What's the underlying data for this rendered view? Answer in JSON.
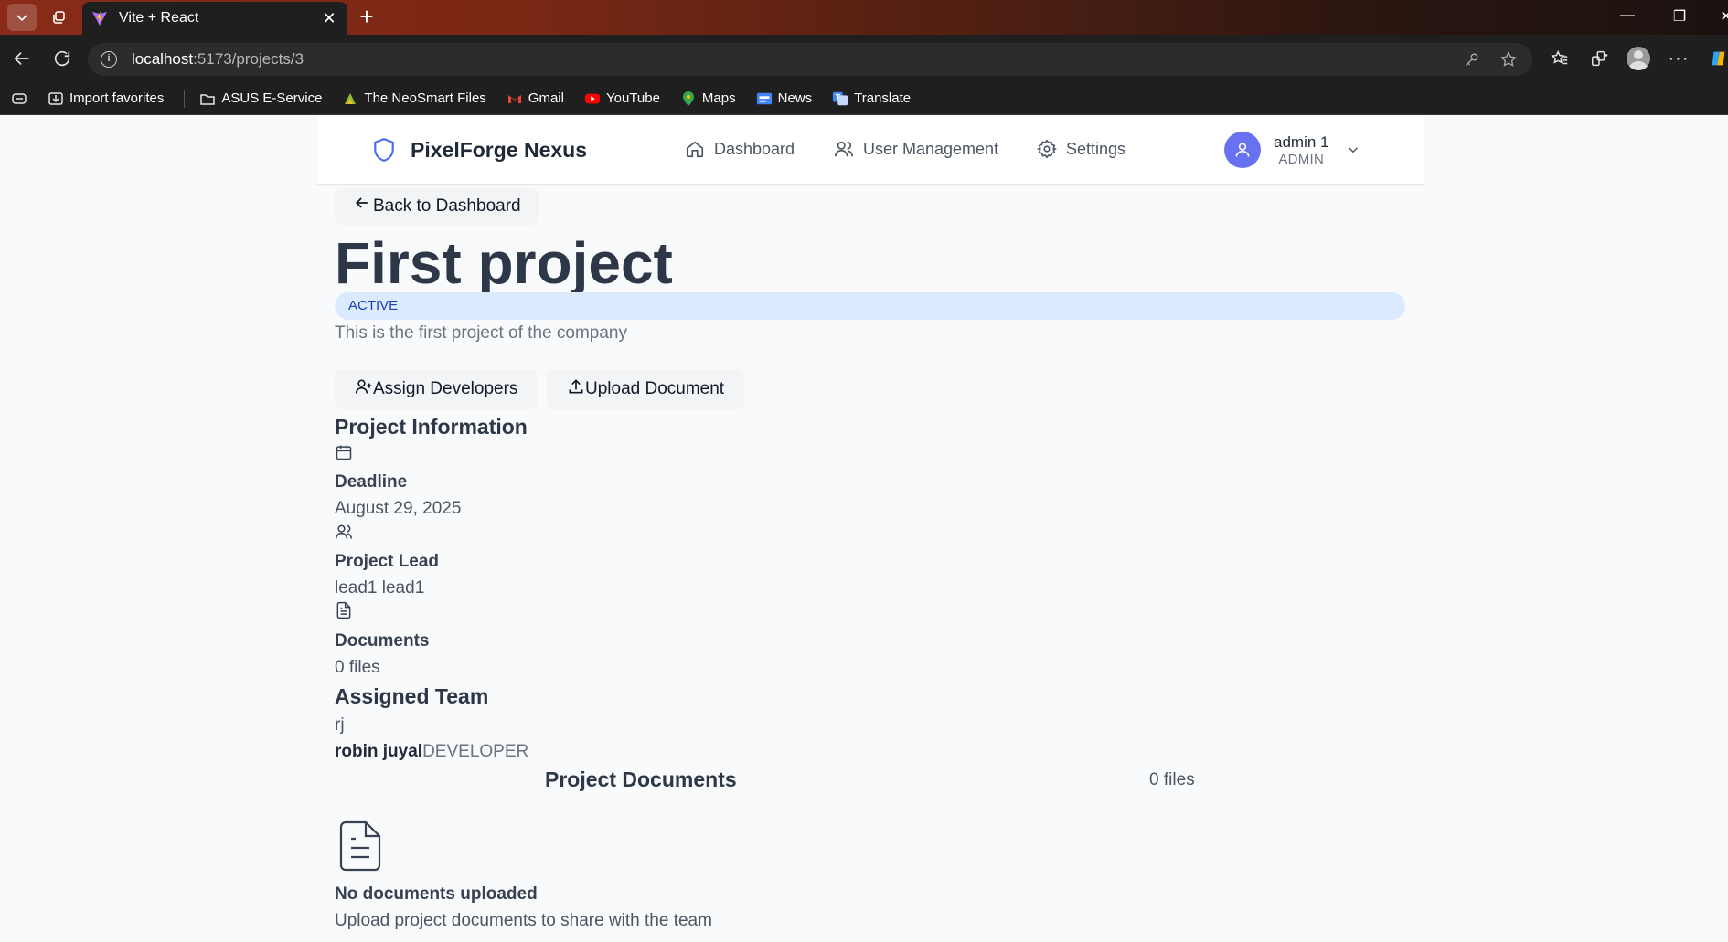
{
  "browser": {
    "tab_title": "Vite + React",
    "url_host": "localhost",
    "url_path": ":5173/projects/3",
    "favorites": [
      {
        "label": "Import favorites",
        "icon": "import-icon"
      },
      {
        "label": "ASUS E-Service",
        "icon": "folder-icon"
      },
      {
        "label": "The NeoSmart Files",
        "icon": "neosmart-icon"
      },
      {
        "label": "Gmail",
        "icon": "gmail-icon"
      },
      {
        "label": "YouTube",
        "icon": "youtube-icon"
      },
      {
        "label": "Maps",
        "icon": "maps-icon"
      },
      {
        "label": "News",
        "icon": "news-icon"
      },
      {
        "label": "Translate",
        "icon": "translate-icon"
      }
    ]
  },
  "header": {
    "brand": "PixelForge Nexus",
    "nav": [
      {
        "label": "Dashboard",
        "icon": "home-icon"
      },
      {
        "label": "User Management",
        "icon": "users-icon"
      },
      {
        "label": "Settings",
        "icon": "gear-icon"
      }
    ],
    "user": {
      "name": "admin 1",
      "role": "ADMIN"
    }
  },
  "page": {
    "back_label": "Back to Dashboard",
    "title": "First project",
    "status": "ACTIVE",
    "description": "This is the first project of the company",
    "actions": {
      "assign": "Assign Developers",
      "upload": "Upload Document"
    }
  },
  "info": {
    "title": "Project Information",
    "deadline_label": "Deadline",
    "deadline_value": "August 29, 2025",
    "lead_label": "Project Lead",
    "lead_value": "lead1 lead1",
    "documents_label": "Documents",
    "documents_value": "0 files"
  },
  "team": {
    "title": "Assigned Team",
    "initials": "rj",
    "members": [
      {
        "name": "robin juyal",
        "role": "DEVELOPER"
      }
    ]
  },
  "documents": {
    "title": "Project Documents",
    "count": "0 files",
    "empty_title": "No documents uploaded",
    "empty_sub": "Upload project documents to share with the team"
  },
  "colors": {
    "accent": "#4f6bed",
    "avatar": "#6872f0",
    "badge_bg": "#dbeafe",
    "badge_text": "#1e40af"
  }
}
